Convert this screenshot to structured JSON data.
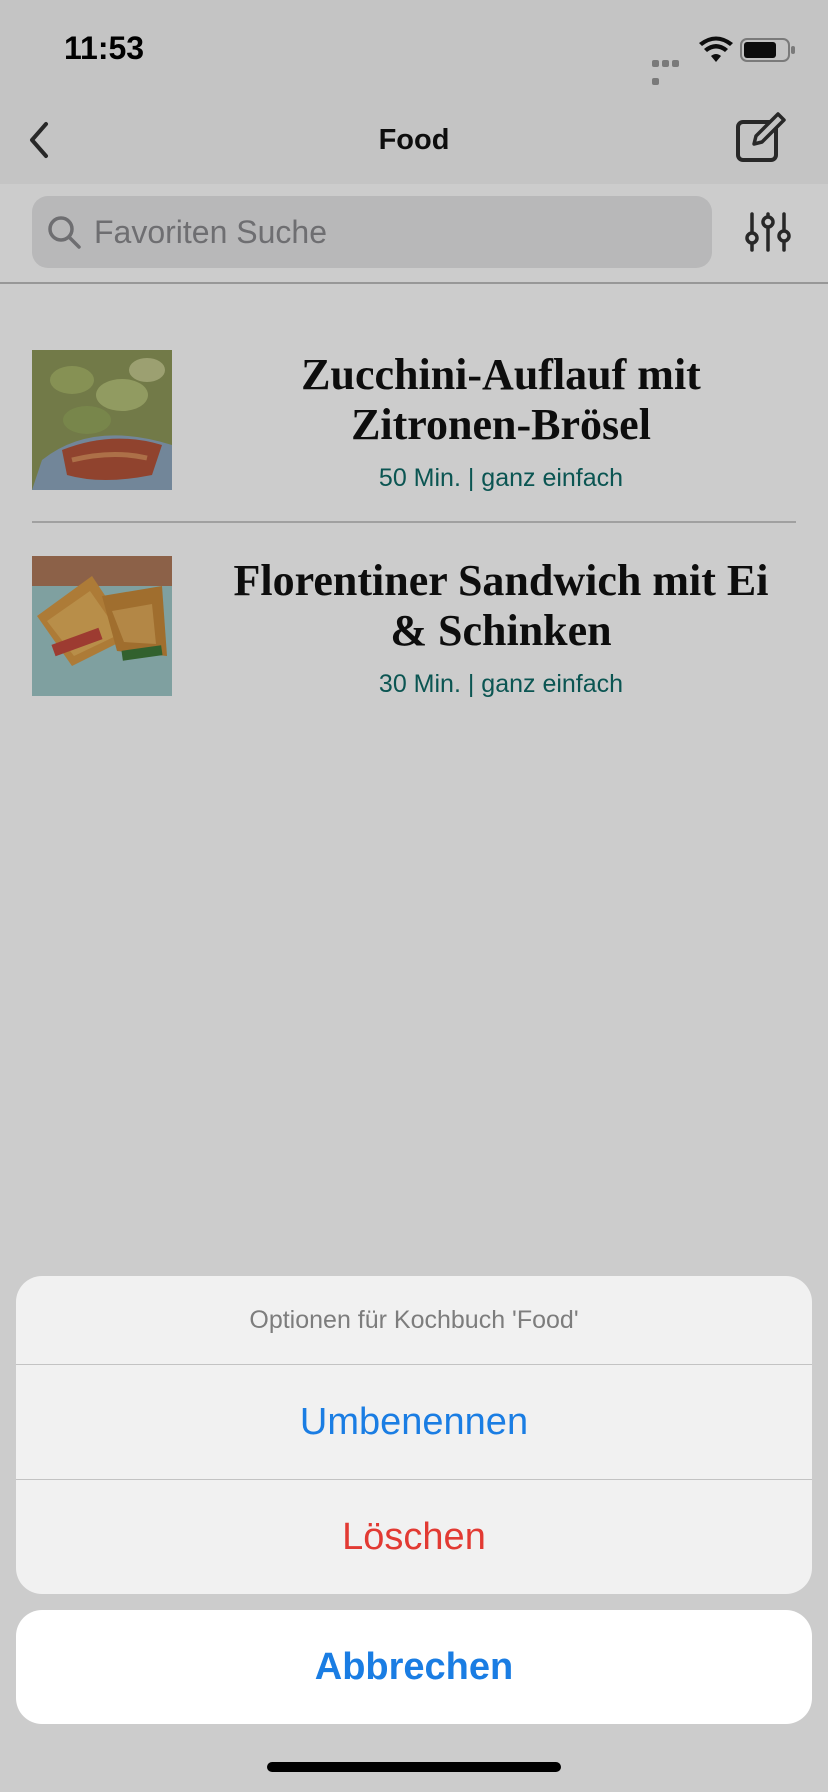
{
  "status_bar": {
    "time": "11:53"
  },
  "nav": {
    "title": "Food"
  },
  "search": {
    "placeholder": "Favoriten Suche"
  },
  "recipes": [
    {
      "title": "Zucchini-Auflauf mit Zitronen-Brösel",
      "meta": "50 Min. | ganz einfach"
    },
    {
      "title": "Florentiner Sandwich mit Ei & Schinken",
      "meta": "30 Min. | ganz einfach"
    }
  ],
  "action_sheet": {
    "title": "Optionen für Kochbuch 'Food'",
    "rename": "Umbenennen",
    "delete": "Löschen",
    "cancel": "Abbrechen"
  },
  "colors": {
    "accent_blue": "#1a7de3",
    "destructive_red": "#e23a33",
    "meta_teal": "#0e6b67"
  },
  "icons": [
    "back-icon",
    "edit-icon",
    "search-icon",
    "filter-icon",
    "wifi-icon",
    "battery-icon",
    "signal-icon"
  ]
}
